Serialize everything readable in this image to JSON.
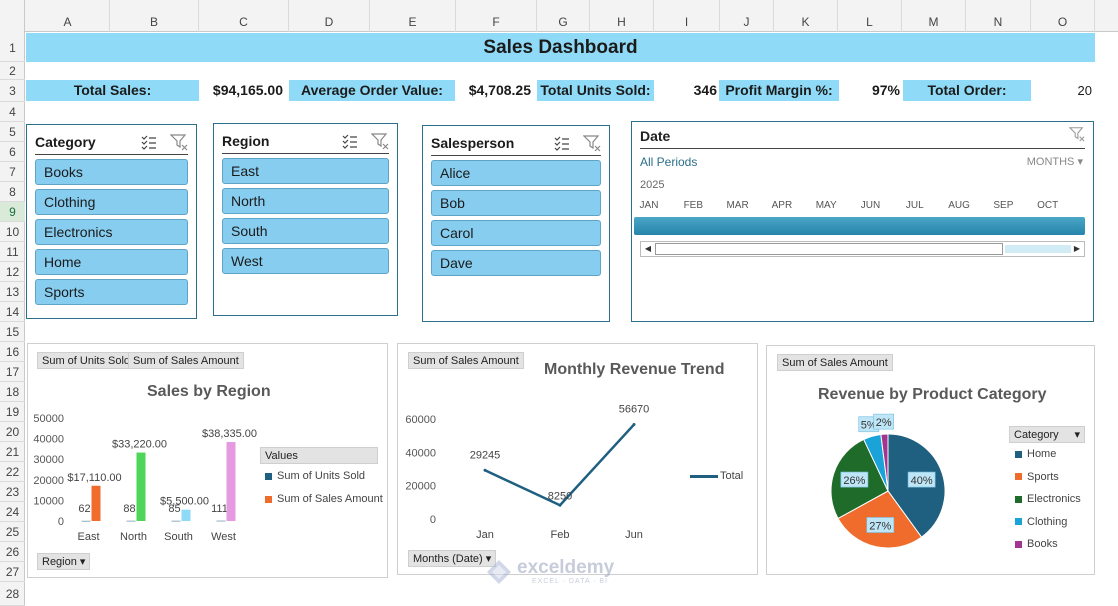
{
  "grid": {
    "columns": [
      "A",
      "B",
      "C",
      "D",
      "E",
      "F",
      "G",
      "H",
      "I",
      "J",
      "K",
      "L",
      "M",
      "N",
      "O"
    ],
    "rows": [
      "1",
      "2",
      "3",
      "4",
      "5",
      "6",
      "7",
      "8",
      "9",
      "10",
      "11",
      "12",
      "13",
      "14",
      "15",
      "16",
      "17",
      "18",
      "19",
      "20",
      "21",
      "22",
      "23",
      "24",
      "25",
      "26",
      "27",
      "28"
    ],
    "selected_row": "9"
  },
  "dashboard": {
    "title": "Sales Dashboard"
  },
  "kpis": [
    {
      "label": "Total Sales:",
      "value": "$94,165.00"
    },
    {
      "label": "Average Order Value:",
      "value": "$4,708.25"
    },
    {
      "label": "Total Units Sold:",
      "value": "346"
    },
    {
      "label": "Profit Margin %:",
      "value": "97%"
    },
    {
      "label": "Total Order:",
      "value": "20"
    }
  ],
  "slicers": {
    "category": {
      "title": "Category",
      "items": [
        "Books",
        "Clothing",
        "Electronics",
        "Home",
        "Sports"
      ]
    },
    "region": {
      "title": "Region",
      "items": [
        "East",
        "North",
        "South",
        "West"
      ]
    },
    "salesperson": {
      "title": "Salesperson",
      "items": [
        "Alice",
        "Bob",
        "Carol",
        "Dave"
      ]
    }
  },
  "timeline": {
    "title": "Date",
    "periods_label": "All Periods",
    "level": "MONTHS",
    "year": "2025",
    "months": [
      "JAN",
      "FEB",
      "MAR",
      "APR",
      "MAY",
      "JUN",
      "JUL",
      "AUG",
      "SEP",
      "OCT"
    ]
  },
  "charts": {
    "region": {
      "field_buttons": [
        "Sum of Units Sold",
        "Sum of Sales Amount"
      ],
      "axis_button": "Region",
      "legend_title": "Values"
    },
    "monthly": {
      "field_button": "Sum of Sales Amount",
      "axis_button": "Months (Date)"
    },
    "category": {
      "field_button": "Sum of Sales Amount",
      "legend_title": "Category"
    }
  },
  "chart_data": [
    {
      "type": "bar",
      "title": "Sales by Region",
      "categories": [
        "East",
        "North",
        "South",
        "West"
      ],
      "ylim": [
        0,
        50000
      ],
      "yticks": [
        0,
        10000,
        20000,
        30000,
        40000,
        50000
      ],
      "series": [
        {
          "name": "Sum of Units Sold",
          "values": [
            62,
            88,
            85,
            111
          ],
          "labels": [
            "62",
            "88",
            "85",
            "111"
          ],
          "color": "#1f5f80"
        },
        {
          "name": "Sum of Sales Amount",
          "values": [
            17110,
            33220,
            5500,
            38335
          ],
          "labels": [
            "$17,110.00",
            "$33,220.00",
            "$5,500.00",
            "$38,335.00"
          ],
          "color": "#ef6c2c"
        }
      ],
      "bar_colors": [
        "#ef6c2c",
        "#4fd65a",
        "#8fdaf6",
        "#e69ae0"
      ],
      "legend": "right"
    },
    {
      "type": "line",
      "title": "Monthly Revenue Trend",
      "categories": [
        "Jan",
        "Feb",
        "Jun"
      ],
      "ylim": [
        0,
        60000
      ],
      "yticks": [
        0,
        20000,
        40000,
        60000
      ],
      "series": [
        {
          "name": "Total",
          "values": [
            29245,
            8250,
            56670
          ],
          "labels": [
            "29245",
            "8250",
            "56670"
          ],
          "color": "#1f5f80"
        }
      ],
      "legend": "right"
    },
    {
      "type": "pie",
      "title": "Revenue by Product Category",
      "slices": [
        {
          "label": "Home",
          "value": 40,
          "text": "40%",
          "color": "#1f5f80"
        },
        {
          "label": "Sports",
          "value": 27,
          "text": "27%",
          "color": "#ef6c2c"
        },
        {
          "label": "Electronics",
          "value": 26,
          "text": "26%",
          "color": "#1e6b2a"
        },
        {
          "label": "Clothing",
          "value": 5,
          "text": "5%",
          "color": "#1aa3d9"
        },
        {
          "label": "Books",
          "value": 2,
          "text": "2%",
          "color": "#a23591"
        }
      ],
      "legend": "right"
    }
  ],
  "watermark": {
    "name": "exceldemy",
    "tagline": "EXCEL · DATA · BI"
  }
}
